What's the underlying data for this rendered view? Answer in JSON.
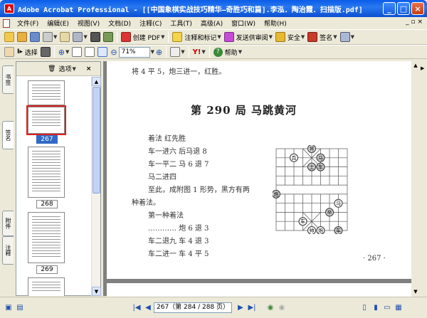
{
  "window": {
    "title": "Adobe Acrobat Professional - [[中国象棋实战技巧精华—奇胜巧和篇].李泓．陶治霞．扫描版.pdf]",
    "controls": [
      "_",
      "□",
      "×"
    ]
  },
  "menubar": {
    "items": [
      "文件(F)",
      "编辑(E)",
      "视图(V)",
      "文档(D)",
      "注释(C)",
      "工具(T)",
      "高级(A)",
      "窗口(W)",
      "帮助(H)"
    ],
    "right": "_ ▫ ×"
  },
  "toolbar1": {
    "create_pdf": "创建 PDF",
    "comment_markup": "注释和标记",
    "send_review": "发送供审阅",
    "security": "安全",
    "sign": "签名"
  },
  "toolbar2": {
    "select": "选择",
    "zoom": "71%",
    "help": "帮助"
  },
  "sidetabs": [
    "书签",
    "签名",
    "附件",
    "注释"
  ],
  "panel": {
    "options": "选项",
    "close": "×",
    "thumbnails": [
      {
        "label": "267",
        "selected": true
      },
      {
        "label": "268",
        "selected": false
      },
      {
        "label": "269",
        "selected": false
      }
    ]
  },
  "page": {
    "top_line": "将 4 平 5，炮三进一，红胜。",
    "title": "第 290 局    马跳黄河",
    "lines": [
      "着法   红先胜",
      "车一进六          后马退 8",
      "车一平二          马 6 退 7",
      "马二进四",
      "至此，成附图 1 形势，黑方有两",
      "种着法。",
      "第一种着法",
      "…………          炮 6 退 3",
      "车二退九          车 4 退 3",
      "车二进一          车 4 平 5"
    ],
    "page_number": "· 267 ·",
    "board_pieces": [
      "将",
      "马",
      "兵",
      "士",
      "车",
      "炮",
      "卒",
      "帅"
    ]
  },
  "statusbar": {
    "page_field": "267（第 284 / 288 页）"
  }
}
